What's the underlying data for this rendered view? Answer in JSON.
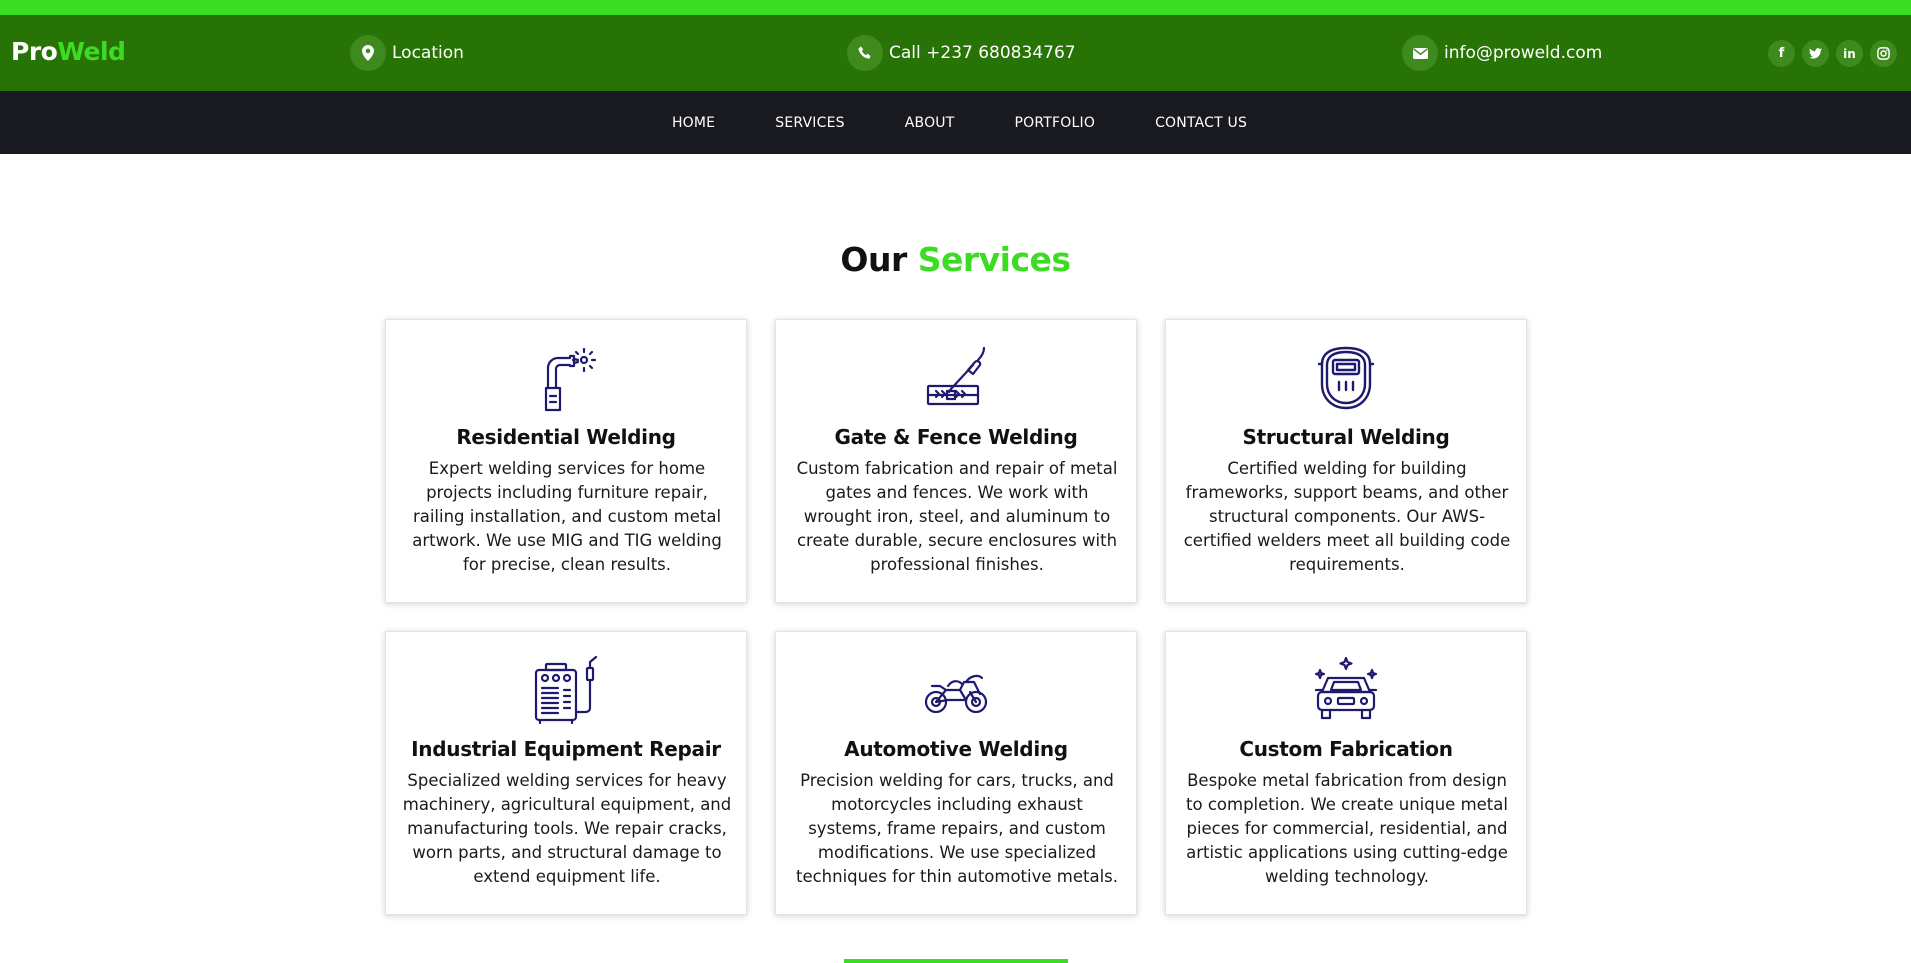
{
  "brand": {
    "part1": "Pro",
    "part2": "Weld"
  },
  "topbar": {
    "location": "Location",
    "phone": "Call +237 680834767",
    "email": "info@proweld.com",
    "socials": [
      {
        "icon": "facebook-icon",
        "glyph": "f"
      },
      {
        "icon": "twitter-icon",
        "glyph": "t"
      },
      {
        "icon": "linkedin-icon",
        "glyph": "in"
      },
      {
        "icon": "instagram-icon",
        "glyph": "◎"
      }
    ]
  },
  "nav": {
    "items": [
      {
        "label": "HOME"
      },
      {
        "label": "SERVICES"
      },
      {
        "label": "ABOUT"
      },
      {
        "label": "PORTFOLIO"
      },
      {
        "label": "CONTACT US"
      }
    ]
  },
  "section": {
    "title_part1": "Our",
    "title_part2": "Services"
  },
  "services": [
    {
      "icon": "welding-torch-icon",
      "title": "Residential Welding",
      "desc": "Expert welding services for home projects including furniture repair, railing installation, and custom metal artwork. We use MIG and TIG welding for precise, clean results."
    },
    {
      "icon": "welding-plate-icon",
      "title": "Gate & Fence Welding",
      "desc": "Custom fabrication and repair of metal gates and fences. We work with wrought iron, steel, and aluminum to create durable, secure enclosures with professional finishes."
    },
    {
      "icon": "welding-mask-icon",
      "title": "Structural Welding",
      "desc": "Certified welding for building frameworks, support beams, and other structural components. Our AWS-certified welders meet all building code requirements."
    },
    {
      "icon": "welding-machine-icon",
      "title": "Industrial Equipment Repair",
      "desc": "Specialized welding services for heavy machinery, agricultural equipment, and manufacturing tools. We repair cracks, worn parts, and structural damage to extend equipment life."
    },
    {
      "icon": "motorcycle-icon",
      "title": "Automotive Welding",
      "desc": "Precision welding for cars, trucks, and motorcycles including exhaust systems, frame repairs, and custom modifications. We use specialized techniques for thin automotive metals."
    },
    {
      "icon": "car-sparkle-icon",
      "title": "Custom Fabrication",
      "desc": "Bespoke metal fabrication from design to completion. We create unique metal pieces for commercial, residential, and artistic applications using cutting-edge welding technology."
    }
  ],
  "colors": {
    "accent": "#3ddc24",
    "topbar_bg": "#287305",
    "navbar_bg": "#181a1f",
    "icon_stroke": "#1f1a6e"
  }
}
